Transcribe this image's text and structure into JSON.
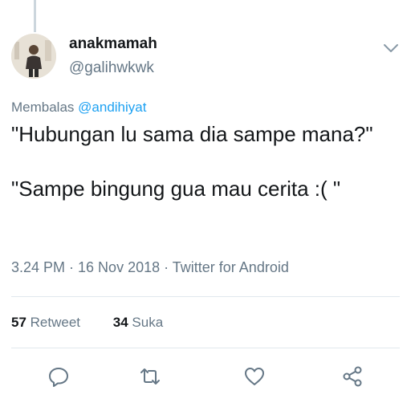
{
  "tweet": {
    "author_name": "anakmamah",
    "author_handle": "@galihwkwk",
    "reply_prefix": "Membalas",
    "reply_mention": "@andihiyat",
    "text": "\"Hubungan lu sama dia sampe mana?\"\n\n\"Sampe bingung gua mau cerita :( \"",
    "timestamp": "3.24 PM · 16 Nov 2018 · Twitter for Android"
  },
  "stats": {
    "retweets_count": "57",
    "retweets_label": "Retweet",
    "likes_count": "34",
    "likes_label": "Suka"
  },
  "icons": {
    "menu": "chevron-down-icon",
    "reply": "reply-icon",
    "retweet": "retweet-icon",
    "like": "heart-icon",
    "share": "share-icon"
  },
  "colors": {
    "text": "#14171a",
    "secondary": "#657786",
    "link": "#1da1f2",
    "divider": "#e1e8ed"
  }
}
